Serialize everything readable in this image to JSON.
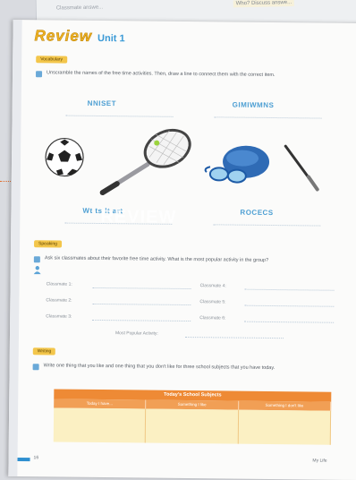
{
  "back_page": {
    "text_left": "Classmate answe...",
    "text_right": "Who? Discuss answe..."
  },
  "header": {
    "title": "Review",
    "unit": "Unit 1"
  },
  "vocabulary": {
    "tag": "Vocabulary",
    "instruction": "Unscramble the names of the free time activities. Then, draw a line to connect them with the correct item.",
    "scrambled": [
      "NNISET",
      "GIMIWMNS",
      "Wt ts lt art",
      "ROCECS"
    ]
  },
  "watermark": "REVIEW",
  "speaking": {
    "tag": "Speaking",
    "instruction": "Ask six classmates about their favorite free time activity. What is the most popular activity in the group?",
    "classmates_left": [
      "Classmate 1:",
      "Classmate 2:",
      "Classmate 3:"
    ],
    "classmates_right": [
      "Classmate 4:",
      "Classmate 5:",
      "Classmate 6:"
    ],
    "most_popular": "Most Popular Activity:"
  },
  "writing": {
    "tag": "Writing",
    "instruction": "Write one thing that you like and one thing that you don't like for three school subjects that you have today.",
    "table_title": "Today's School Subjects",
    "columns": [
      "Today I have...",
      "Something I like",
      "Something I don't like"
    ]
  },
  "footer": {
    "page_number": "16",
    "book_title": "My Life"
  },
  "colors": {
    "title_yellow": "#f0b323",
    "accent_blue": "#3b9ad6",
    "table_orange": "#ee8a35",
    "table_fill": "#fbf0c3"
  }
}
